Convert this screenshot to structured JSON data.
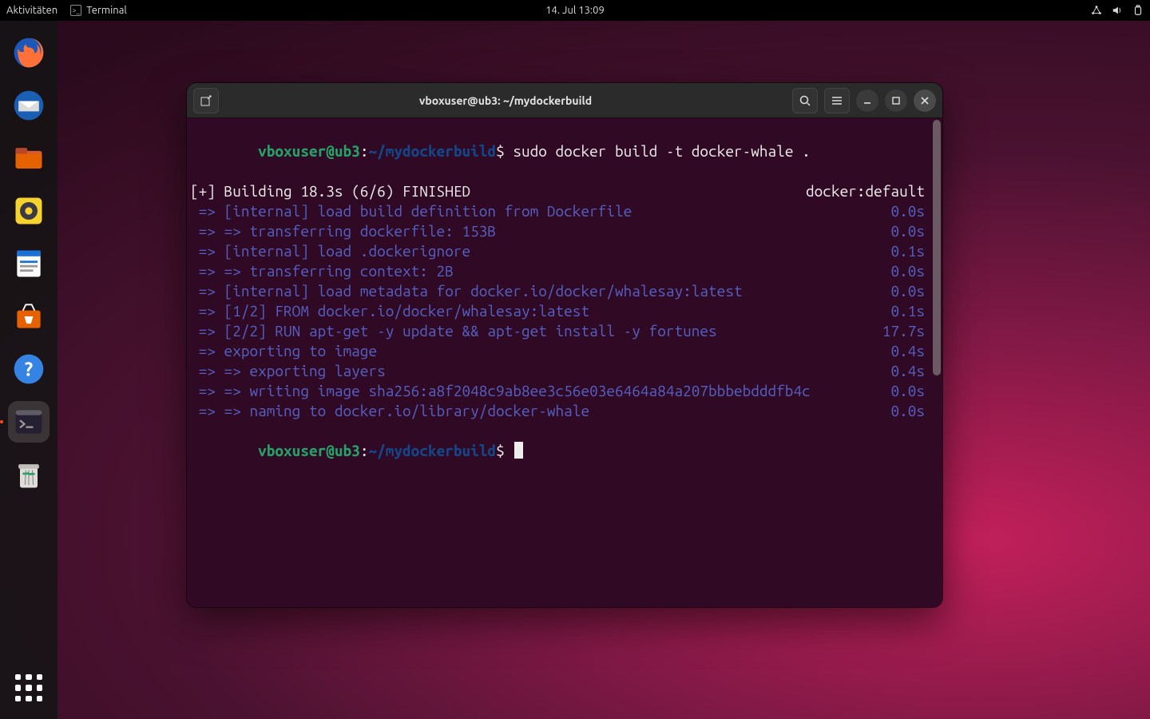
{
  "topbar": {
    "activities": "Aktivitäten",
    "taskLabel": "Terminal",
    "clock": "14. Jul  13:09"
  },
  "dock": {
    "items": [
      {
        "name": "firefox"
      },
      {
        "name": "thunderbird"
      },
      {
        "name": "files"
      },
      {
        "name": "rhythmbox"
      },
      {
        "name": "libreoffice-writer"
      },
      {
        "name": "ubuntu-software"
      },
      {
        "name": "help"
      },
      {
        "name": "terminal",
        "active": true
      },
      {
        "name": "trash"
      }
    ]
  },
  "window": {
    "title": "vboxuser@ub3: ~/mydockerbuild"
  },
  "prompt": {
    "userHost": "vboxuser@ub3",
    "sep": ":",
    "path": "~/mydockerbuild",
    "sigil": "$"
  },
  "command": " sudo docker build -t docker-whale .",
  "header": {
    "left": "[+] Building 18.3s (6/6) FINISHED",
    "right": "docker:default"
  },
  "steps": [
    {
      "l": " => [internal] load build definition from Dockerfile",
      "r": "0.0s"
    },
    {
      "l": " => => transferring dockerfile: 153B",
      "r": "0.0s"
    },
    {
      "l": " => [internal] load .dockerignore",
      "r": "0.1s"
    },
    {
      "l": " => => transferring context: 2B",
      "r": "0.0s"
    },
    {
      "l": " => [internal] load metadata for docker.io/docker/whalesay:latest",
      "r": "0.0s"
    },
    {
      "l": " => [1/2] FROM docker.io/docker/whalesay:latest",
      "r": "0.1s"
    },
    {
      "l": " => [2/2] RUN apt-get -y update && apt-get install -y fortunes",
      "r": "17.7s"
    },
    {
      "l": " => exporting to image",
      "r": "0.4s"
    },
    {
      "l": " => => exporting layers",
      "r": "0.4s"
    },
    {
      "l": " => => writing image sha256:a8f2048c9ab8ee3c56e03e6464a84a207bbbebdddfb4c",
      "r": "0.0s"
    },
    {
      "l": " => => naming to docker.io/library/docker-whale",
      "r": "0.0s"
    }
  ]
}
